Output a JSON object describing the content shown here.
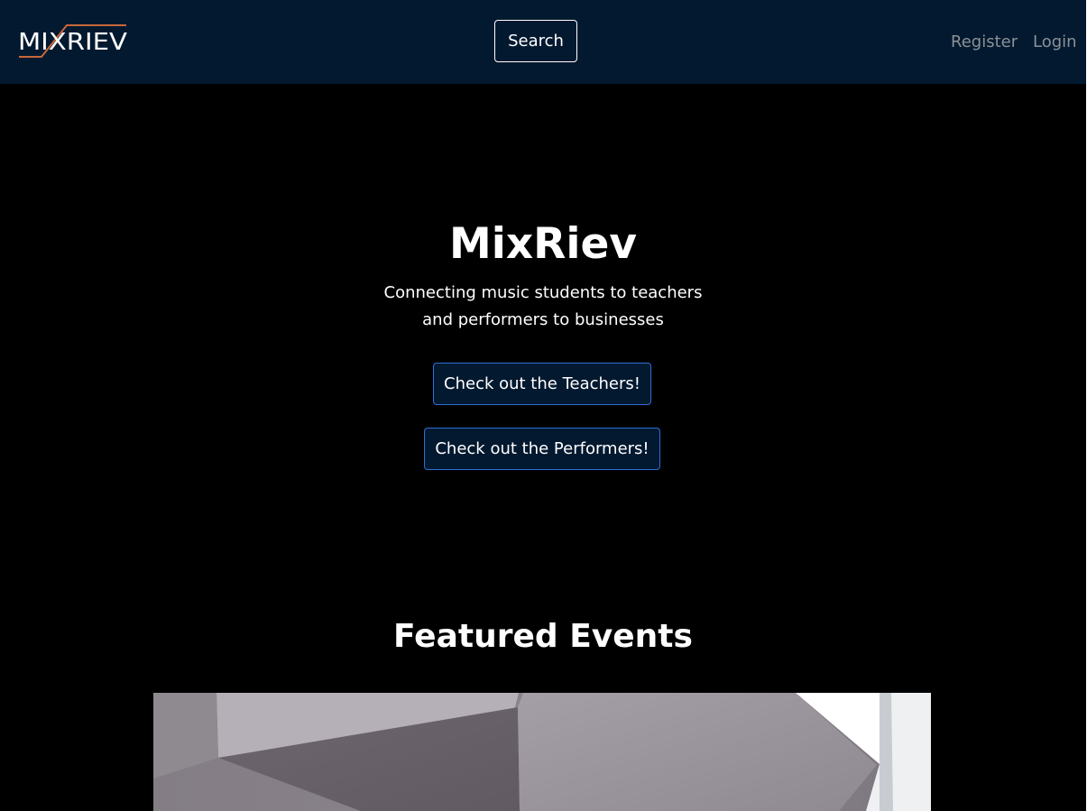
{
  "nav": {
    "logo_text": "MIXRIEV",
    "search_label": "Search",
    "register_label": "Register",
    "login_label": "Login"
  },
  "hero": {
    "title": "MixRiev",
    "subtitle_line1": "Connecting music students to teachers",
    "subtitle_line2": "and performers to businesses",
    "teachers_button": "Check out the Teachers!",
    "performers_button": "Check out the Performers!"
  },
  "featured": {
    "title": "Featured Events"
  },
  "colors": {
    "navbar_bg": "#031930",
    "page_bg": "#000000",
    "button_border": "#2f6fd6",
    "logo_accent": "#c8673a",
    "nav_link": "#8c9196"
  }
}
